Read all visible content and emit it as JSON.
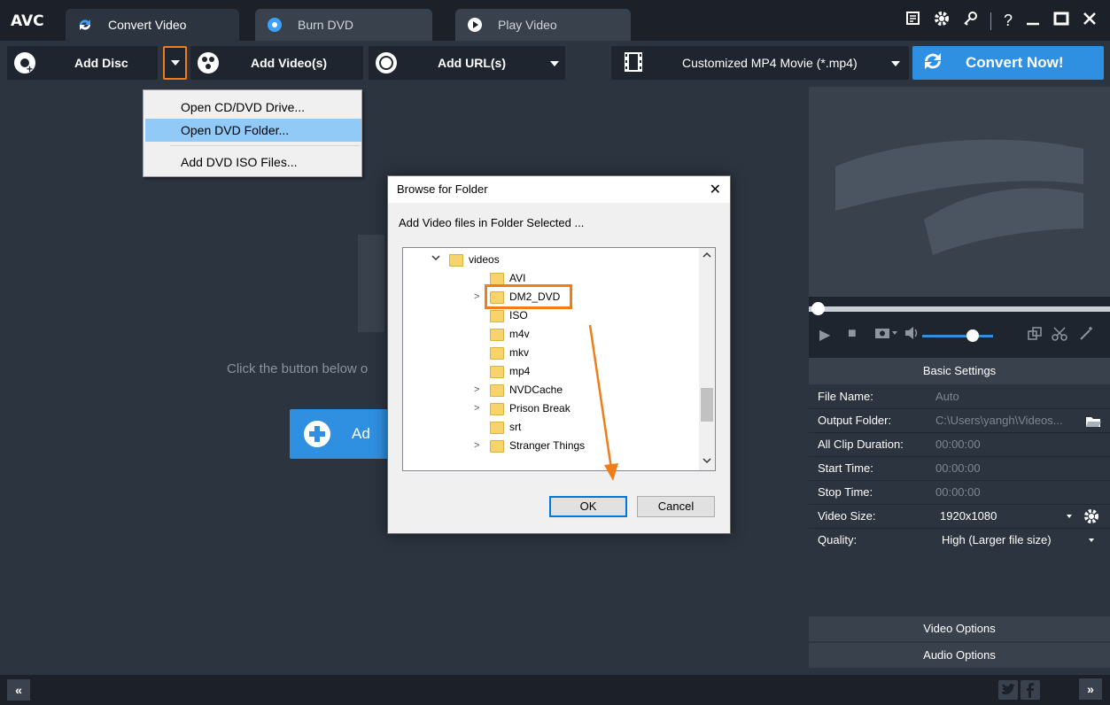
{
  "app": {
    "logo": "AVC",
    "tabs": [
      {
        "label": "Convert Video"
      },
      {
        "label": "Burn DVD"
      },
      {
        "label": "Play Video"
      }
    ],
    "window_controls": [
      "?"
    ]
  },
  "toolbar": {
    "add_disc": "Add Disc",
    "add_videos": "Add Video(s)",
    "add_urls": "Add URL(s)",
    "profile": "Customized MP4 Movie (*.mp4)",
    "convert": "Convert Now!"
  },
  "disc_menu": {
    "items": [
      "Open CD/DVD Drive...",
      "Open DVD Folder...",
      "Add DVD ISO Files..."
    ],
    "selected": "Open DVD Folder..."
  },
  "main": {
    "hint": "Click the button below o",
    "big_button": "Ad"
  },
  "browse_dialog": {
    "title": "Browse for Folder",
    "subtitle": "Add Video files in Folder Selected ...",
    "tree": [
      {
        "label": "videos",
        "expander": "✓"
      },
      {
        "label": "AVI",
        "expander": ""
      },
      {
        "label": "DM2_DVD",
        "expander": ">"
      },
      {
        "label": "ISO",
        "expander": ""
      },
      {
        "label": "m4v",
        "expander": ""
      },
      {
        "label": "mkv",
        "expander": ""
      },
      {
        "label": "mp4",
        "expander": ""
      },
      {
        "label": "NVDCache",
        "expander": ">"
      },
      {
        "label": "Prison Break",
        "expander": ">"
      },
      {
        "label": "srt",
        "expander": ""
      },
      {
        "label": "Stranger Things",
        "expander": ">"
      }
    ],
    "selected": "DM2_DVD",
    "ok": "OK",
    "cancel": "Cancel"
  },
  "settings": {
    "title": "Basic Settings",
    "rows": [
      {
        "label": "File Name:",
        "value": "Auto"
      },
      {
        "label": "Output Folder:",
        "value": "C:\\Users\\yangh\\Videos..."
      },
      {
        "label": "All Clip Duration:",
        "value": "00:00:00"
      },
      {
        "label": "Start Time:",
        "value": "00:00:00"
      },
      {
        "label": "Stop Time:",
        "value": "00:00:00"
      },
      {
        "label": "Video Size:",
        "value": "1920x1080"
      },
      {
        "label": "Quality:",
        "value": "High (Larger file size)"
      }
    ],
    "video_options": "Video Options",
    "audio_options": "Audio Options"
  },
  "statusbar": {
    "collapse": "«",
    "expand": "»"
  },
  "colors": {
    "accent": "#2f8fe0",
    "highlight": "#f07d1a",
    "menu_selected": "#91c9f7"
  }
}
